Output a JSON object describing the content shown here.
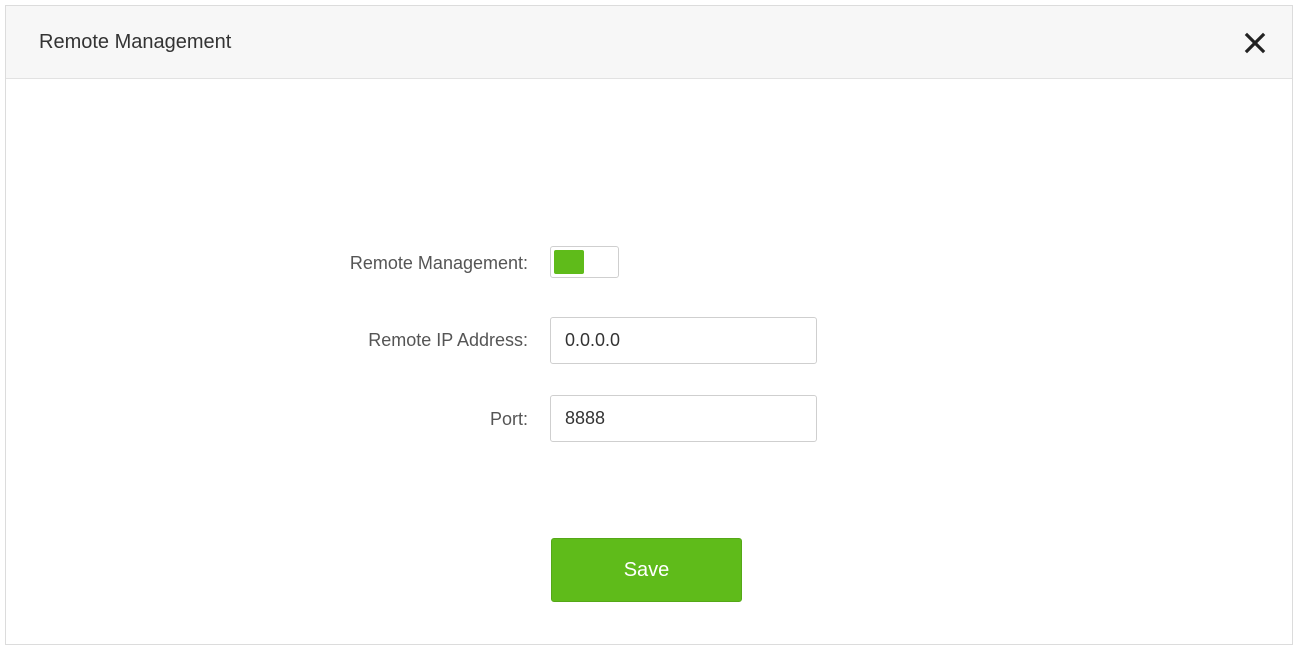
{
  "dialog": {
    "title": "Remote Management",
    "close_icon": "close-icon"
  },
  "form": {
    "remote_management": {
      "label": "Remote Management:",
      "enabled": true,
      "accent_color": "#5fbb1a"
    },
    "remote_ip": {
      "label": "Remote IP Address:",
      "value": "0.0.0.0"
    },
    "port": {
      "label": "Port:",
      "value": "8888"
    }
  },
  "actions": {
    "save_label": "Save"
  }
}
